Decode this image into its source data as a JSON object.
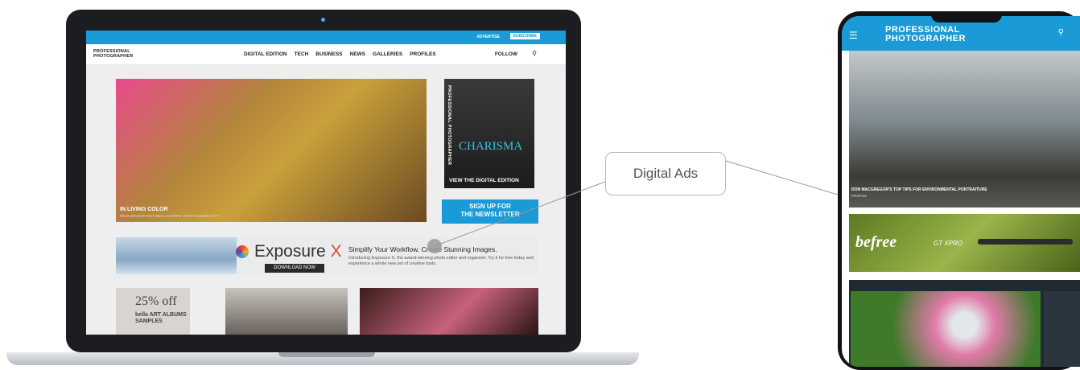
{
  "laptop_site": {
    "topbar": {
      "advertise": "ADVERTISE",
      "subscribe": "SUBSCRIBE"
    },
    "logo": [
      "PROFESSIONAL",
      "PHOTOGRAPHER"
    ],
    "nav": [
      "DIGITAL EDITION",
      "TECH",
      "BUSINESS",
      "NEWS",
      "GALLERIES",
      "PROFILES"
    ],
    "follow": "FOLLOW",
    "search_icon": "search-icon",
    "hero": {
      "title": "IN LIVING COLOR",
      "subtitle": "DEAN BRADSHAW'S REAL IS MORE VIVID THAN REALITY"
    },
    "magazine": {
      "masthead": "PROFESSIONAL PHOTOGRAPHER",
      "cover_word": "CHARISMA",
      "cta": "VIEW THE DIGITAL EDITION"
    },
    "newsletter": [
      "SIGN UP FOR",
      "THE NEWSLETTER"
    ],
    "ad": {
      "brand": "Exposure",
      "brand_x": "X",
      "download": "DOWNLOAD NOW",
      "headline": "Simplify Your Workflow. Create Stunning Images.",
      "body": "Introducing Exposure X, the award-winning photo editor and organizer. Try it for free today and experience a whole new set of creative tools."
    },
    "promo": {
      "line1": "25% off",
      "line2": [
        "bella ART ALBUMS",
        "SAMPLES"
      ]
    }
  },
  "callout": {
    "label": "Digital Ads"
  },
  "phone_site": {
    "logo": [
      "PROFESSIONAL",
      "PHOTOGRAPHER"
    ],
    "menu_icon": "hamburger-icon",
    "search_icon": "search-icon",
    "hero": {
      "title": "DON MACGREGOR'S TOP TIPS FOR ENVIRONMENTAL PORTRAITURE",
      "subtitle": "PROFILE"
    },
    "ad": {
      "brand": "befree",
      "model": "GT XPRO"
    }
  },
  "colors": {
    "brand_blue": "#1a9ad6",
    "exposure_red": "#e5452f"
  }
}
